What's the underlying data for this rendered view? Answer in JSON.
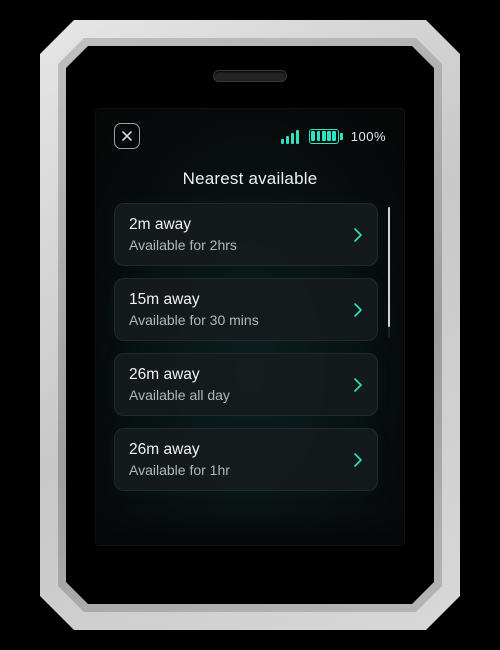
{
  "status": {
    "battery_pct": "100%"
  },
  "header": {
    "title": "Nearest available"
  },
  "list": {
    "items": [
      {
        "title": "2m away",
        "subtitle": "Available for 2hrs"
      },
      {
        "title": "15m away",
        "subtitle": "Available for 30 mins"
      },
      {
        "title": "26m away",
        "subtitle": "Available all day"
      },
      {
        "title": "26m away",
        "subtitle": "Available for 1hr"
      }
    ]
  },
  "colors": {
    "accent": "#2fe3c0"
  }
}
